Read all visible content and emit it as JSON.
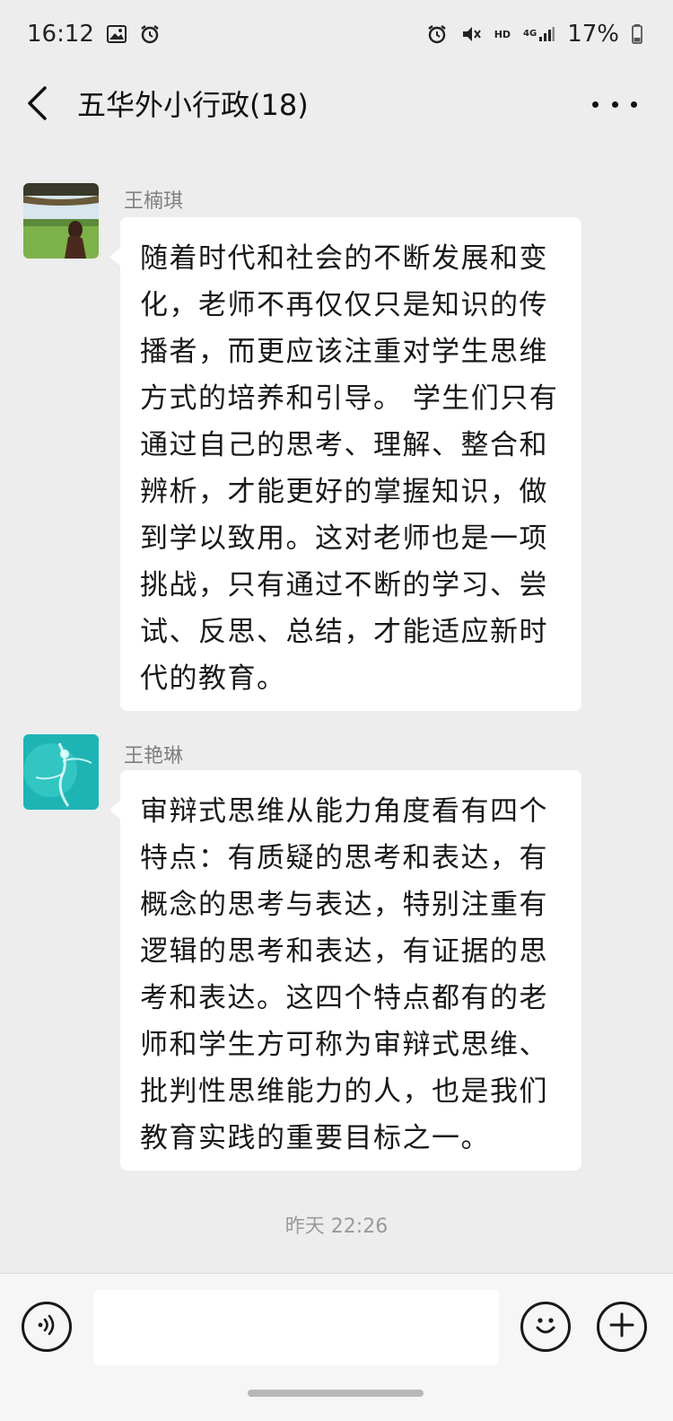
{
  "status_bar": {
    "time": "16:12",
    "network_hd": "HD",
    "network_4g": "4G",
    "battery": "17%"
  },
  "header": {
    "title": "五华外小行政(18)"
  },
  "messages": [
    {
      "sender": "王楠琪",
      "text": "随着时代和社会的不断发展和变化，老师不再仅仅只是知识的传播者，而更应该注重对学生思维方式的培养和引导。 学生们只有通过自己的思考、理解、整合和辨析，才能更好的掌握知识，做到学以致用。这对老师也是一项挑战，只有通过不断的学习、尝试、反思、总结，才能适应新时代的教育。"
    },
    {
      "sender": "王艳琳",
      "text": "审辩式思维从能力角度看有四个特点：有质疑的思考和表达，有概念的思考与表达，特别注重有逻辑的思考和表达，有证据的思考和表达。这四个特点都有的老师和学生方可称为审辩式思维、批判性思维能力的人，也是我们教育实践的重要目标之一。"
    }
  ],
  "timestamp": "昨天 22:26",
  "icons": {
    "back": "back-chevron-icon",
    "more": "more-dots-icon",
    "voice": "voice-icon",
    "emoji": "emoji-icon",
    "plus": "plus-icon"
  }
}
